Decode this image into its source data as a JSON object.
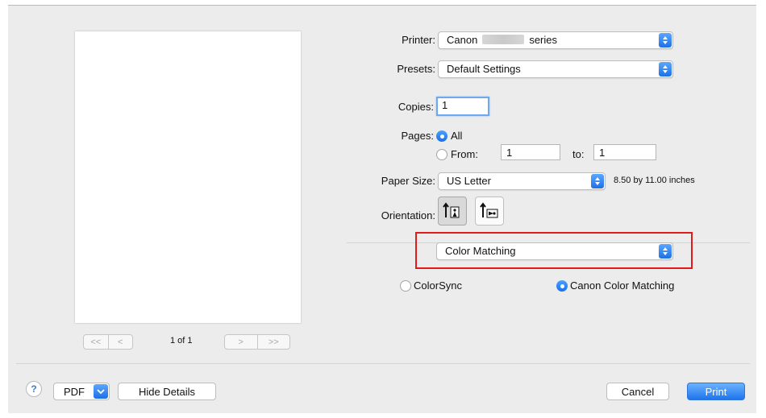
{
  "preview": {
    "first_label": "<<",
    "prev_label": "<",
    "page_indicator": "1 of 1",
    "next_label": ">",
    "last_label": ">>"
  },
  "printer": {
    "label": "Printer:",
    "value_prefix": "Canon",
    "value_suffix": "series"
  },
  "presets": {
    "label": "Presets:",
    "value": "Default Settings"
  },
  "copies": {
    "label": "Copies:",
    "value": "1"
  },
  "pages": {
    "label": "Pages:",
    "all_label": "All",
    "from_label": "From:",
    "from_value": "1",
    "to_label": "to:",
    "to_value": "1"
  },
  "paper_size": {
    "label": "Paper Size:",
    "value": "US Letter",
    "dimensions": "8.50 by 11.00 inches"
  },
  "orientation": {
    "label": "Orientation:"
  },
  "section_popup": {
    "value": "Color Matching"
  },
  "color_options": {
    "colorsync_label": "ColorSync",
    "canon_label": "Canon Color Matching",
    "selected": "Canon Color Matching"
  },
  "footer": {
    "help_label": "?",
    "pdf_label": "PDF",
    "hide_details_label": "Hide Details",
    "cancel_label": "Cancel",
    "print_label": "Print"
  },
  "colors": {
    "accent": "#1f74ec",
    "highlight": "#e11b1b"
  }
}
